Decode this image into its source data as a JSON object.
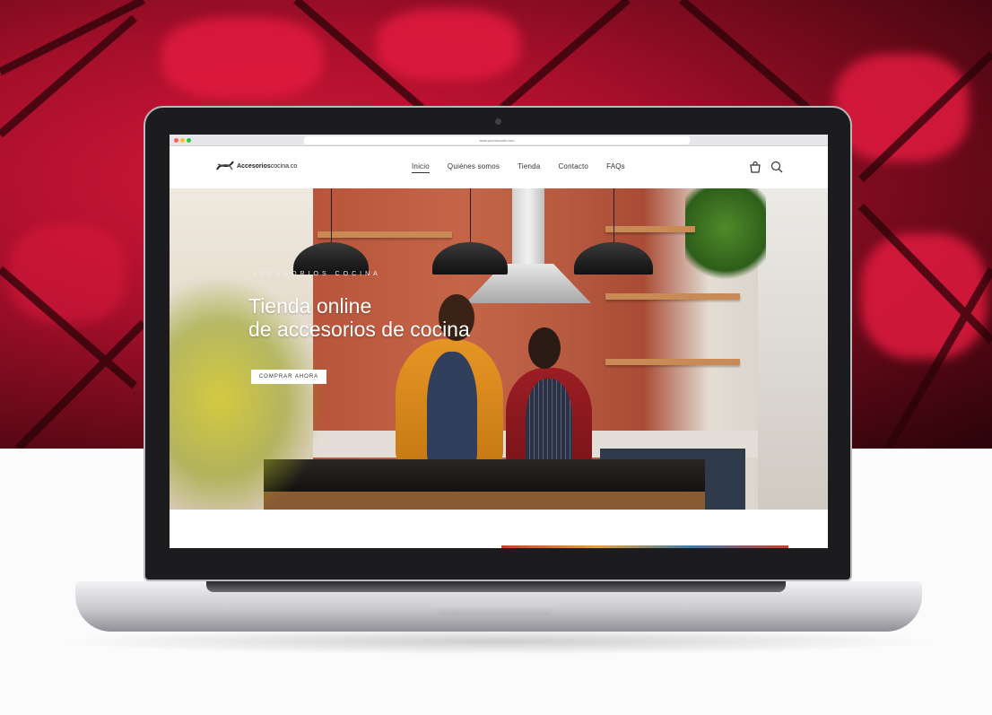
{
  "browser": {
    "url": "www.yourdomain.com"
  },
  "header": {
    "logo": {
      "bold": "Accesorios",
      "light": "cocina.co"
    },
    "nav": [
      {
        "label": "Inicio",
        "active": true
      },
      {
        "label": "Quiénes somos",
        "active": false
      },
      {
        "label": "Tienda",
        "active": false
      },
      {
        "label": "Contacto",
        "active": false
      },
      {
        "label": "FAQs",
        "active": false
      }
    ],
    "icons": [
      "cart-icon",
      "search-icon"
    ]
  },
  "hero": {
    "eyebrow": "ACCESORIOS COCINA",
    "title_line1": "Tienda online",
    "title_line2": "de accesorios de cocina",
    "cta_label": "COMPRAR AHORA"
  },
  "colors": {
    "backdrop": "#c8102e",
    "cta_bg": "#ffffff",
    "laptop_bezel": "#1c1c1e"
  }
}
